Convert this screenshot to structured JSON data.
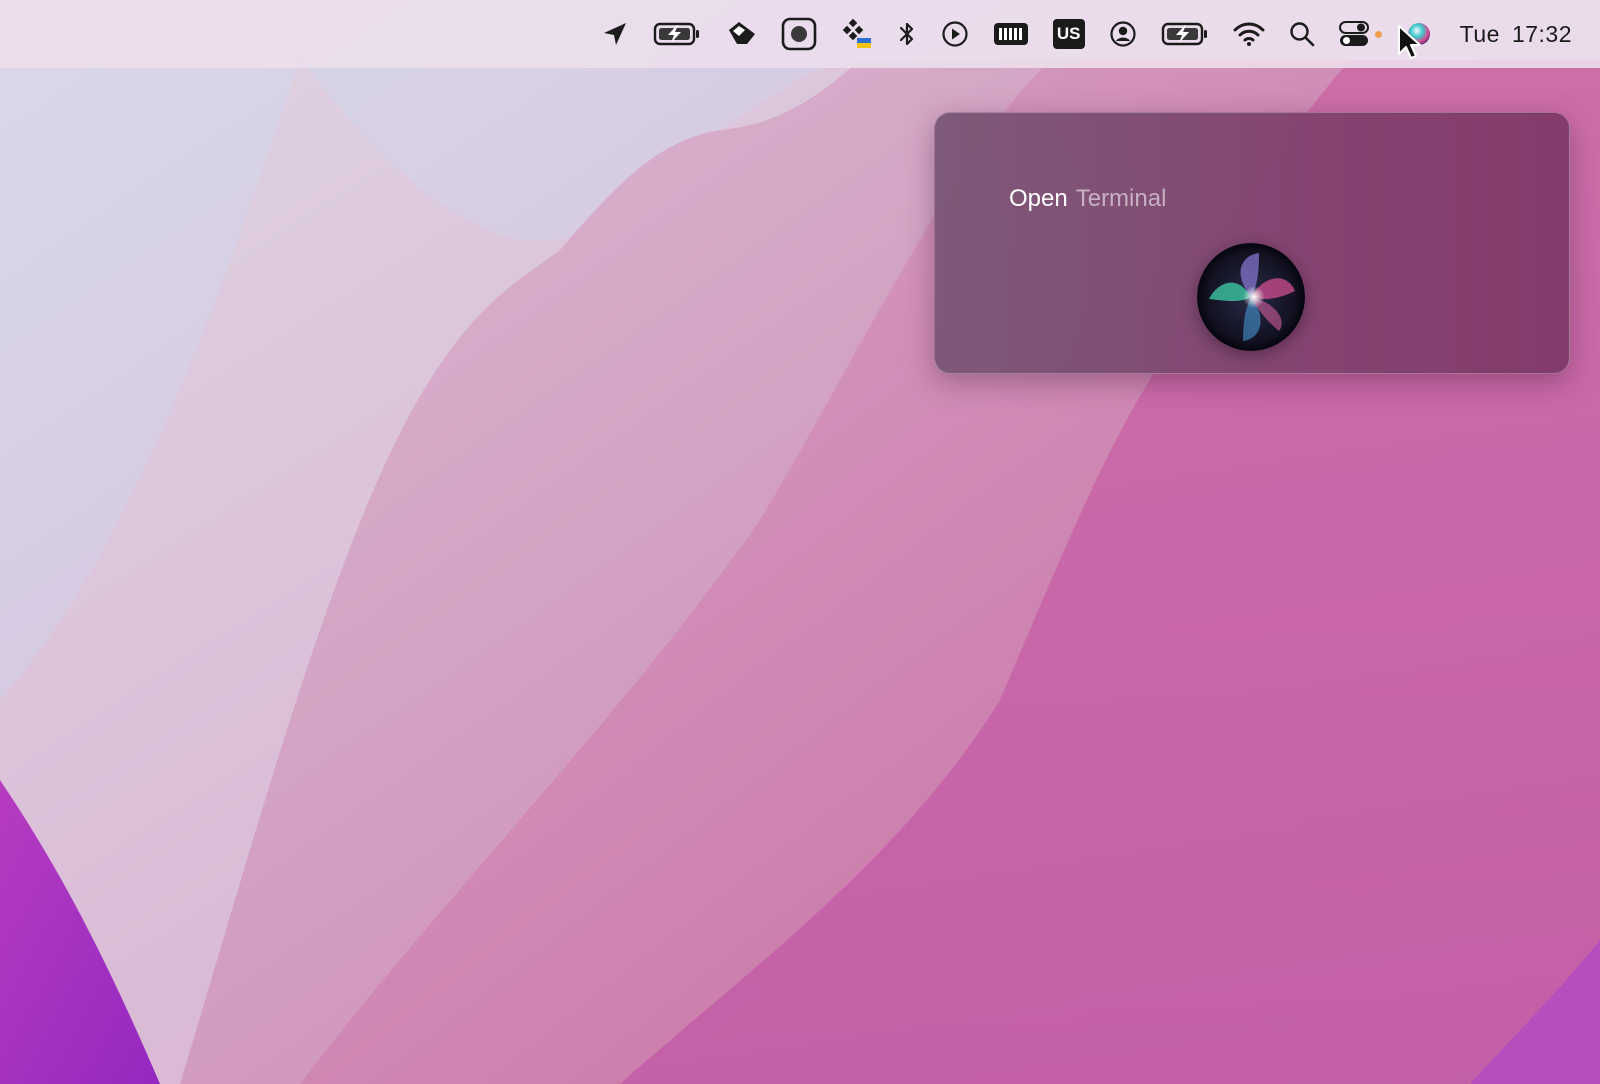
{
  "menubar": {
    "items": [
      {
        "name": "location-arrow-icon",
        "label": ""
      },
      {
        "name": "battery-charging-icon",
        "label": ""
      },
      {
        "name": "eraser-app-icon",
        "label": ""
      },
      {
        "name": "screenshot-app-icon",
        "label": ""
      },
      {
        "name": "diamond-grid-app-icon",
        "label": ""
      },
      {
        "name": "bluetooth-icon",
        "label": ""
      },
      {
        "name": "play-circle-icon",
        "label": ""
      },
      {
        "name": "memory-meter-icon",
        "label": ""
      },
      {
        "name": "input-source-icon",
        "label": "US"
      },
      {
        "name": "user-account-icon",
        "label": ""
      },
      {
        "name": "battery-charging-icon-2",
        "label": ""
      },
      {
        "name": "wifi-icon",
        "label": ""
      },
      {
        "name": "spotlight-search-icon",
        "label": ""
      },
      {
        "name": "control-center-icon",
        "label": ""
      },
      {
        "name": "siri-icon",
        "label": ""
      }
    ],
    "clock": {
      "day": "Tue",
      "time": "17:32"
    },
    "indicator_color": "#f0a050"
  },
  "siri": {
    "query_verb": "Open",
    "query_object": "Terminal"
  },
  "colors": {
    "menubar_bg": "#ecdeec",
    "panel_bg": "#82426e",
    "wallpaper_accent": "#c968a0"
  }
}
